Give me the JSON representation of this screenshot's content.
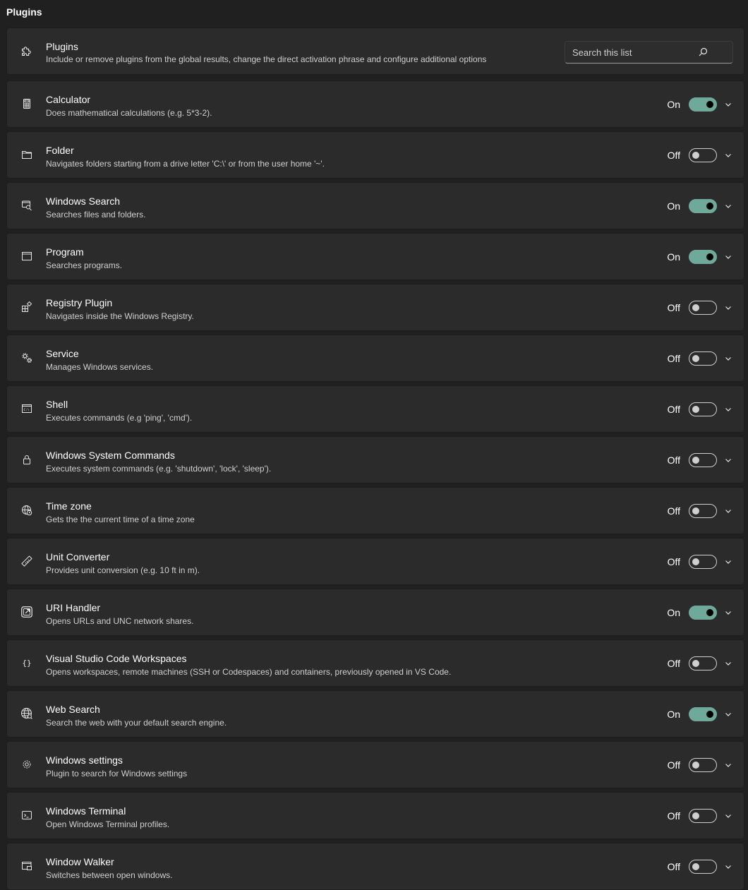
{
  "section_title": "Plugins",
  "header_card": {
    "title": "Plugins",
    "description": "Include or remove plugins from the global results, change the direct activation phrase and configure additional options",
    "icon": "puzzle-icon",
    "search_placeholder": "Search this list"
  },
  "on_label": "On",
  "off_label": "Off",
  "colors": {
    "background": "#202020",
    "card": "#2b2b2b",
    "toggle_on": "#6fa99a"
  },
  "plugins": [
    {
      "title": "Calculator",
      "description": "Does mathematical calculations (e.g. 5*3-2).",
      "enabled": true,
      "state_label": "On",
      "icon": "calculator-icon"
    },
    {
      "title": "Folder",
      "description": "Navigates folders starting from a drive letter 'C:\\' or from the user home '~'.",
      "enabled": false,
      "state_label": "Off",
      "icon": "folder-icon"
    },
    {
      "title": "Windows Search",
      "description": "Searches files and folders.",
      "enabled": true,
      "state_label": "On",
      "icon": "windows-search-icon"
    },
    {
      "title": "Program",
      "description": "Searches programs.",
      "enabled": true,
      "state_label": "On",
      "icon": "program-window-icon"
    },
    {
      "title": "Registry Plugin",
      "description": "Navigates inside the Windows Registry.",
      "enabled": false,
      "state_label": "Off",
      "icon": "registry-icon"
    },
    {
      "title": "Service",
      "description": "Manages Windows services.",
      "enabled": false,
      "state_label": "Off",
      "icon": "service-gears-icon"
    },
    {
      "title": "Shell",
      "description": "Executes commands (e.g 'ping', 'cmd').",
      "enabled": false,
      "state_label": "Off",
      "icon": "shell-icon"
    },
    {
      "title": "Windows System Commands",
      "description": "Executes system commands (e.g. 'shutdown', 'lock', 'sleep').",
      "enabled": false,
      "state_label": "Off",
      "icon": "lock-icon"
    },
    {
      "title": "Time zone",
      "description": "Gets the the current time of a time zone",
      "enabled": false,
      "state_label": "Off",
      "icon": "globe-clock-icon"
    },
    {
      "title": "Unit Converter",
      "description": "Provides unit conversion (e.g. 10 ft in m).",
      "enabled": false,
      "state_label": "Off",
      "icon": "ruler-icon"
    },
    {
      "title": "URI Handler",
      "description": "Opens URLs and UNC network shares.",
      "enabled": true,
      "state_label": "On",
      "icon": "open-link-icon"
    },
    {
      "title": "Visual Studio Code Workspaces",
      "description": "Opens workspaces, remote machines (SSH or Codespaces) and containers, previously opened in VS Code.",
      "enabled": false,
      "state_label": "Off",
      "icon": "braces-icon"
    },
    {
      "title": "Web Search",
      "description": "Search the web with your default search engine.",
      "enabled": true,
      "state_label": "On",
      "icon": "web-globe-icon"
    },
    {
      "title": "Windows settings",
      "description": "Plugin to search for Windows settings",
      "enabled": false,
      "state_label": "Off",
      "icon": "settings-gear-icon"
    },
    {
      "title": "Windows Terminal",
      "description": "Open Windows Terminal profiles.",
      "enabled": false,
      "state_label": "Off",
      "icon": "terminal-icon"
    },
    {
      "title": "Window Walker",
      "description": "Switches between open windows.",
      "enabled": false,
      "state_label": "Off",
      "icon": "window-walker-icon"
    }
  ]
}
